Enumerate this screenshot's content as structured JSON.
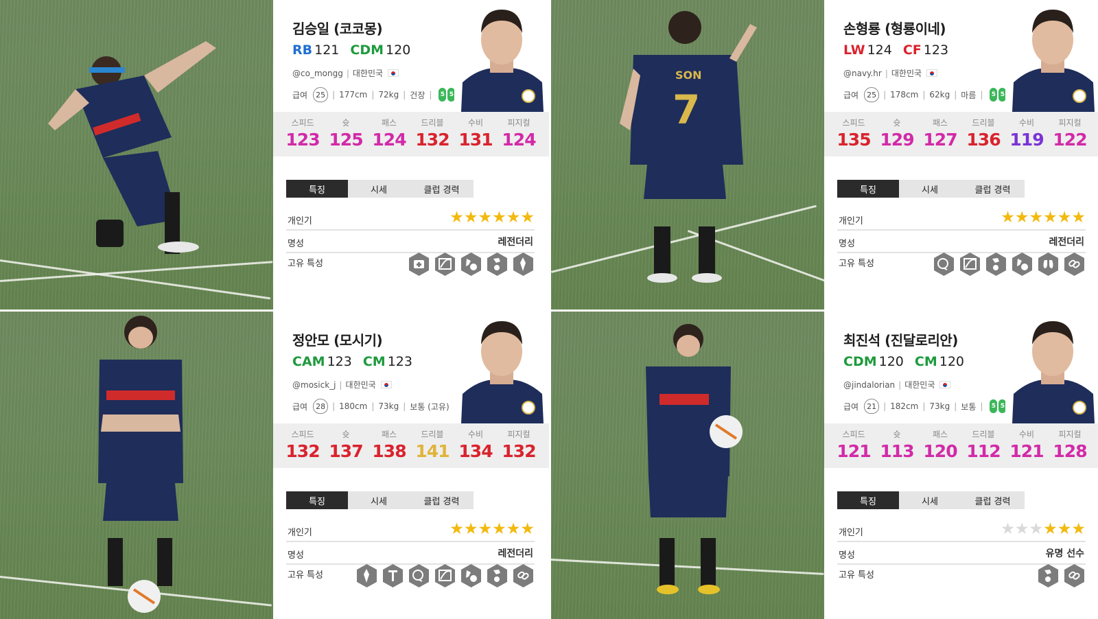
{
  "tab_labels": [
    "특징",
    "시세",
    "클럽 경력"
  ],
  "stat_labels": [
    "스피드",
    "슛",
    "패스",
    "드리블",
    "수비",
    "피지컬"
  ],
  "row_labels": {
    "popularity": "개인기",
    "fame": "명성",
    "traits": "고유 특성"
  },
  "salary_label": "급여",
  "star_color": "#f2b90f",
  "players": [
    {
      "name": "김승일 (코코몽)",
      "positions": [
        {
          "code": "RB",
          "value": "121",
          "color": "#1f6fd1"
        },
        {
          "code": "CDM",
          "value": "120",
          "color": "#1e9a3d"
        }
      ],
      "handle": "@co_mongg",
      "country": "대한민국",
      "salary": "25",
      "height": "177cm",
      "weight": "72kg",
      "body_type": "건장",
      "foot": [
        "5",
        "5"
      ],
      "stats": [
        {
          "value": "123",
          "color": "#d22aa8"
        },
        {
          "value": "125",
          "color": "#d22aa8"
        },
        {
          "value": "124",
          "color": "#d22aa8"
        },
        {
          "value": "132",
          "color": "#d9232e"
        },
        {
          "value": "131",
          "color": "#d9232e"
        },
        {
          "value": "124",
          "color": "#d22aa8"
        }
      ],
      "popularity_stars": 6,
      "fame": "레전더리",
      "traits": [
        "medic-icon",
        "long-pass-icon",
        "dribble-icon",
        "shooter-icon",
        "tiki-taka-icon"
      ]
    },
    {
      "name": "손형룡 (형룡이네)",
      "positions": [
        {
          "code": "LW",
          "value": "124",
          "color": "#d9232e"
        },
        {
          "code": "CF",
          "value": "123",
          "color": "#d9232e"
        }
      ],
      "handle": "@navy.hr",
      "country": "대한민국",
      "salary": "25",
      "height": "178cm",
      "weight": "62kg",
      "body_type": "마름",
      "foot": [
        "5",
        "5"
      ],
      "stats": [
        {
          "value": "135",
          "color": "#d9232e"
        },
        {
          "value": "129",
          "color": "#d22aa8"
        },
        {
          "value": "127",
          "color": "#d22aa8"
        },
        {
          "value": "136",
          "color": "#d9232e"
        },
        {
          "value": "119",
          "color": "#7a33d6"
        },
        {
          "value": "122",
          "color": "#d22aa8"
        }
      ],
      "popularity_stars": 6,
      "fame": "레전더리",
      "traits": [
        "brain-icon",
        "long-pass-icon",
        "shooter-icon",
        "dribble-icon",
        "lungs-icon",
        "link-icon"
      ]
    },
    {
      "name": "정안모 (모시기)",
      "positions": [
        {
          "code": "CAM",
          "value": "123",
          "color": "#1e9a3d"
        },
        {
          "code": "CM",
          "value": "123",
          "color": "#1e9a3d"
        }
      ],
      "handle": "@mosick_j",
      "country": "대한민국",
      "salary": "28",
      "height": "180cm",
      "weight": "73kg",
      "body_type": "보통 (고유)",
      "foot": [
        "5",
        "5"
      ],
      "stats": [
        {
          "value": "132",
          "color": "#d9232e"
        },
        {
          "value": "137",
          "color": "#d9232e"
        },
        {
          "value": "138",
          "color": "#d9232e"
        },
        {
          "value": "141",
          "color": "#e0b43a"
        },
        {
          "value": "134",
          "color": "#d9232e"
        },
        {
          "value": "132",
          "color": "#d9232e"
        }
      ],
      "popularity_stars": 6,
      "fame": "레전더리",
      "traits": [
        "tiki-taka-icon",
        "power-header-icon",
        "brain-icon",
        "long-pass-icon",
        "dribble-icon",
        "shooter-icon",
        "link-icon"
      ]
    },
    {
      "name": "최진석 (진달로리안)",
      "positions": [
        {
          "code": "CDM",
          "value": "120",
          "color": "#1e9a3d"
        },
        {
          "code": "CM",
          "value": "120",
          "color": "#1e9a3d"
        }
      ],
      "handle": "@jindalorian",
      "country": "대한민국",
      "salary": "21",
      "height": "182cm",
      "weight": "73kg",
      "body_type": "보통",
      "foot": [
        "5",
        "5"
      ],
      "stats": [
        {
          "value": "121",
          "color": "#d22aa8"
        },
        {
          "value": "113",
          "color": "#d22aa8"
        },
        {
          "value": "120",
          "color": "#d22aa8"
        },
        {
          "value": "112",
          "color": "#d22aa8"
        },
        {
          "value": "121",
          "color": "#d22aa8"
        },
        {
          "value": "128",
          "color": "#d22aa8"
        }
      ],
      "popularity_stars": 3,
      "fame": "유명 선수",
      "traits": [
        "shooter-icon",
        "link-icon"
      ]
    }
  ]
}
